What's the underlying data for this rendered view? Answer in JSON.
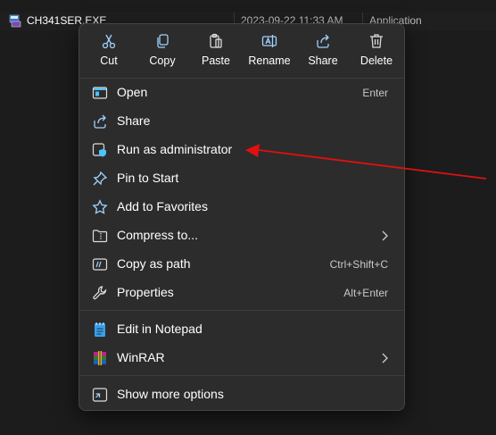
{
  "file": {
    "name": "CH341SER.EXE",
    "date": "2023-09-22 11:33 AM",
    "type": "Application"
  },
  "toolbar": [
    {
      "label": "Cut",
      "icon": "scissors-icon"
    },
    {
      "label": "Copy",
      "icon": "copy-icon"
    },
    {
      "label": "Paste",
      "icon": "paste-icon"
    },
    {
      "label": "Rename",
      "icon": "rename-icon"
    },
    {
      "label": "Share",
      "icon": "share-icon"
    },
    {
      "label": "Delete",
      "icon": "trash-icon"
    }
  ],
  "items": [
    {
      "label": "Open",
      "shortcut": "Enter",
      "icon": "open-window-icon"
    },
    {
      "label": "Share",
      "shortcut": "",
      "icon": "share-icon"
    },
    {
      "label": "Run as administrator",
      "shortcut": "",
      "icon": "admin-shield-icon"
    },
    {
      "label": "Pin to Start",
      "shortcut": "",
      "icon": "pin-icon"
    },
    {
      "label": "Add to Favorites",
      "shortcut": "",
      "icon": "star-icon"
    },
    {
      "label": "Compress to...",
      "shortcut": "",
      "icon": "zip-folder-icon",
      "submenu": true
    },
    {
      "label": "Copy as path",
      "shortcut": "Ctrl+Shift+C",
      "icon": "copy-path-icon"
    },
    {
      "label": "Properties",
      "shortcut": "Alt+Enter",
      "icon": "wrench-icon"
    },
    {
      "label": "Edit in Notepad",
      "shortcut": "",
      "icon": "notepad-icon"
    },
    {
      "label": "WinRAR",
      "shortcut": "",
      "icon": "winrar-icon",
      "submenu": true
    },
    {
      "label": "Show more options",
      "shortcut": "",
      "icon": "more-options-icon"
    }
  ],
  "colors": {
    "menu_bg": "#2c2c2c",
    "accent": "#4cc2ff",
    "annotation_arrow": "#e01010"
  }
}
